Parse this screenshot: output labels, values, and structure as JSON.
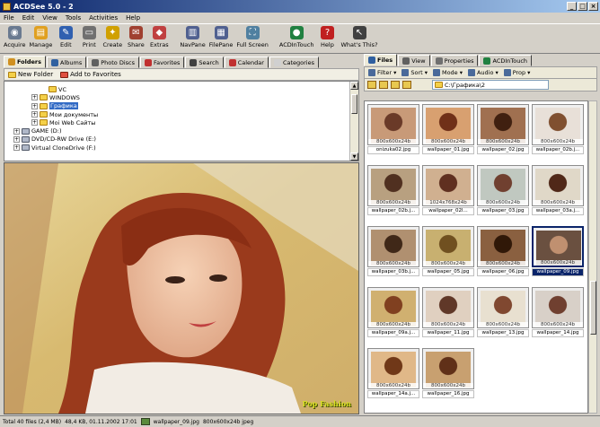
{
  "window": {
    "title": "ACDSee 5.0 - 2",
    "buttons": [
      "_",
      "□",
      "×"
    ]
  },
  "menu": [
    "File",
    "Edit",
    "View",
    "Tools",
    "Activities",
    "Help"
  ],
  "toolbar": [
    {
      "label": "Acquire",
      "icon": "acquire-icon",
      "color": "#6a7a90",
      "glyph": "◉"
    },
    {
      "label": "Manage",
      "icon": "manage-icon",
      "color": "#e0a020",
      "glyph": "▤"
    },
    {
      "label": "Edit",
      "icon": "edit-icon",
      "color": "#3060b0",
      "glyph": "✎"
    },
    {
      "label": "Print",
      "icon": "print-icon",
      "color": "#707070",
      "glyph": "▭"
    },
    {
      "label": "Create",
      "icon": "create-icon",
      "color": "#d0a000",
      "glyph": "✦"
    },
    {
      "label": "Share",
      "icon": "share-icon",
      "color": "#a04030",
      "glyph": "✉"
    },
    {
      "label": "Extras",
      "icon": "extras-icon",
      "color": "#c04040",
      "glyph": "◆"
    },
    {
      "label": "NavPane",
      "icon": "navpane-icon",
      "color": "#506090",
      "glyph": "▥"
    },
    {
      "label": "FilePane",
      "icon": "filepane-icon",
      "color": "#506090",
      "glyph": "▦"
    },
    {
      "label": "Full Screen",
      "icon": "fullscreen-icon",
      "color": "#5080a0",
      "glyph": "⛶"
    },
    {
      "label": "ACDInTouch",
      "icon": "acdintouch-icon",
      "color": "#208040",
      "glyph": "●"
    },
    {
      "label": "Help",
      "icon": "help-icon",
      "color": "#c02020",
      "glyph": "?"
    },
    {
      "label": "What's This?",
      "icon": "whats-this-icon",
      "color": "#404040",
      "glyph": "↖"
    }
  ],
  "left_tabs": [
    {
      "label": "Folders",
      "icon": "folders-icon",
      "color": "#d09020",
      "active": true
    },
    {
      "label": "Albums",
      "icon": "albums-icon",
      "color": "#3060a0"
    },
    {
      "label": "Photo Discs",
      "icon": "photo-discs-icon",
      "color": "#606060"
    },
    {
      "label": "Favorites",
      "icon": "favorites-icon",
      "color": "#c03030"
    },
    {
      "label": "Search",
      "icon": "search-icon",
      "color": "#404040"
    },
    {
      "label": "Calendar",
      "icon": "calendar-icon",
      "color": "#c03030"
    },
    {
      "label": "Categories",
      "icon": "categories-icon",
      "color": "#d0d0d0"
    }
  ],
  "left_subbar": {
    "new_folder": "New Folder",
    "add_favorites": "Add to Favorites"
  },
  "tree": [
    {
      "label": "VC",
      "indent": 4,
      "toggle": ""
    },
    {
      "label": "WINDOWS",
      "indent": 3,
      "toggle": "+"
    },
    {
      "label": "Графика",
      "indent": 3,
      "toggle": "+",
      "selected": true
    },
    {
      "label": "Мои документы",
      "indent": 3,
      "toggle": "+"
    },
    {
      "label": "Moi Web Сайты",
      "indent": 3,
      "toggle": "+"
    },
    {
      "label": "GAME (D:)",
      "indent": 1,
      "toggle": "+"
    },
    {
      "label": "DVD/CD-RW Drive (E:)",
      "indent": 1,
      "toggle": "+"
    },
    {
      "label": "Virtual CloneDrive (F:)",
      "indent": 1,
      "toggle": "+"
    }
  ],
  "right_tabs": [
    {
      "label": "Files",
      "icon": "files-icon",
      "color": "#3060a0",
      "active": true
    },
    {
      "label": "View",
      "icon": "view-icon",
      "color": "#606060"
    },
    {
      "label": "Properties",
      "icon": "properties-icon",
      "color": "#707070"
    },
    {
      "label": "ACDInTouch",
      "icon": "acdintouch-tab-icon",
      "color": "#208040"
    }
  ],
  "right_toolbar": [
    "Filter",
    "Sort",
    "Mode",
    "Audio",
    "Prop"
  ],
  "path": "C:\\Графика\\2",
  "thumbnails": [
    {
      "name": "onizuka02.jpg",
      "dims": "800x600x24b"
    },
    {
      "name": "wallpaper_01.jpg",
      "dims": "800x600x24b"
    },
    {
      "name": "wallpaper_02.jpg",
      "dims": "800x600x24b"
    },
    {
      "name": "wallpaper_02b.j...",
      "dims": "800x600x24b"
    },
    {
      "name": "wallpaper_02b.j...",
      "dims": "800x600x24b"
    },
    {
      "name": "wallpaper_02l...",
      "dims": "1024x768x24b"
    },
    {
      "name": "wallpaper_03.jpg",
      "dims": "800x600x24b"
    },
    {
      "name": "wallpaper_03a.j...",
      "dims": "800x600x24b"
    },
    {
      "name": "wallpaper_03b.j...",
      "dims": "800x600x24b"
    },
    {
      "name": "wallpaper_05.jpg",
      "dims": "800x600x24b"
    },
    {
      "name": "wallpaper_06.jpg",
      "dims": "800x600x24b"
    },
    {
      "name": "wallpaper_09.jpg",
      "dims": "800x600x24b",
      "selected": true
    },
    {
      "name": "wallpaper_09a.j...",
      "dims": "800x600x24b"
    },
    {
      "name": "wallpaper_11.jpg",
      "dims": "800x600x24b"
    },
    {
      "name": "wallpaper_13.jpg",
      "dims": "800x600x24b"
    },
    {
      "name": "wallpaper_14.jpg",
      "dims": "800x600x24b"
    },
    {
      "name": "wallpaper_14a.j...",
      "dims": "800x600x24b"
    },
    {
      "name": "wallpaper_16.jpg",
      "dims": "800x600x24b"
    }
  ],
  "status": {
    "total": "Total 40 files (2,4 MB)",
    "size_date": "48,4 KB, 01.11.2002 17:01",
    "file": "wallpaper_09.jpg",
    "info": "800x600x24b jpeg"
  },
  "preview_watermark": "Pop Fashion"
}
